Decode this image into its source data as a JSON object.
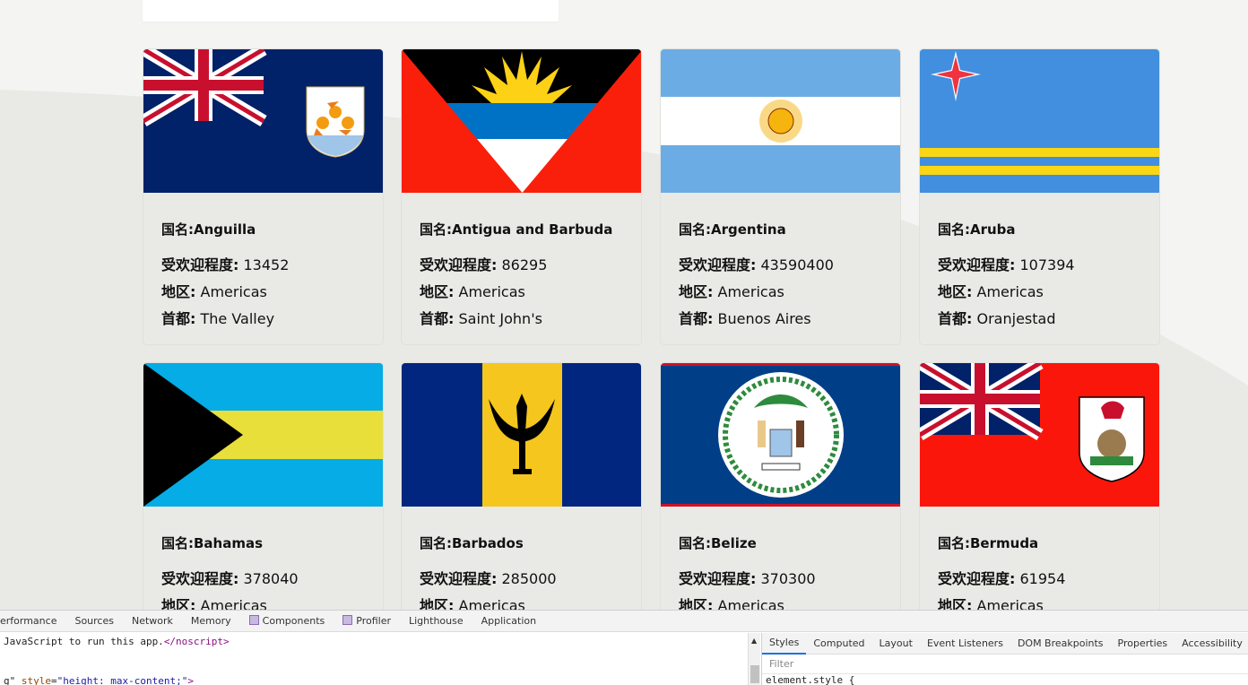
{
  "colors": {
    "page_bg": "#f4f4f2",
    "card_bg": "#e9e9e6",
    "text": "#111111"
  },
  "labels": {
    "name_prefix": "国名:",
    "popularity": "受欢迎程度:",
    "region": "地区:",
    "capital": "首都:"
  },
  "countries": [
    {
      "name": "Anguilla",
      "popularity": "13452",
      "region": "Americas",
      "capital": "The Valley",
      "flag": "anguilla-flag"
    },
    {
      "name": "Antigua and Barbuda",
      "popularity": "86295",
      "region": "Americas",
      "capital": "Saint John's",
      "flag": "antigua-flag"
    },
    {
      "name": "Argentina",
      "popularity": "43590400",
      "region": "Americas",
      "capital": "Buenos Aires",
      "flag": "argentina-flag"
    },
    {
      "name": "Aruba",
      "popularity": "107394",
      "region": "Americas",
      "capital": "Oranjestad",
      "flag": "aruba-flag"
    },
    {
      "name": "Bahamas",
      "popularity": "378040",
      "region": "Americas",
      "capital": "",
      "flag": "bahamas-flag"
    },
    {
      "name": "Barbados",
      "popularity": "285000",
      "region": "Americas",
      "capital": "",
      "flag": "barbados-flag"
    },
    {
      "name": "Belize",
      "popularity": "370300",
      "region": "Americas",
      "capital": "",
      "flag": "belize-flag"
    },
    {
      "name": "Bermuda",
      "popularity": "61954",
      "region": "Americas",
      "capital": "",
      "flag": "bermuda-flag"
    }
  ],
  "devtools": {
    "tabs": [
      "erformance",
      "Sources",
      "Network",
      "Memory",
      "Components",
      "Profiler",
      "Lighthouse",
      "Application"
    ],
    "code_line1_text": " JavaScript to run this app.",
    "code_line1_tag": "</noscript>",
    "code_line2_a": "g\"",
    "code_line2_attr": "style",
    "code_line2_val": "\"height: max-content;\"",
    "code_line2_end": ">",
    "side_tabs": [
      "Styles",
      "Computed",
      "Layout",
      "Event Listeners",
      "DOM Breakpoints",
      "Properties",
      "Accessibility"
    ],
    "filter_placeholder": "Filter",
    "style_text": "element.style {"
  }
}
